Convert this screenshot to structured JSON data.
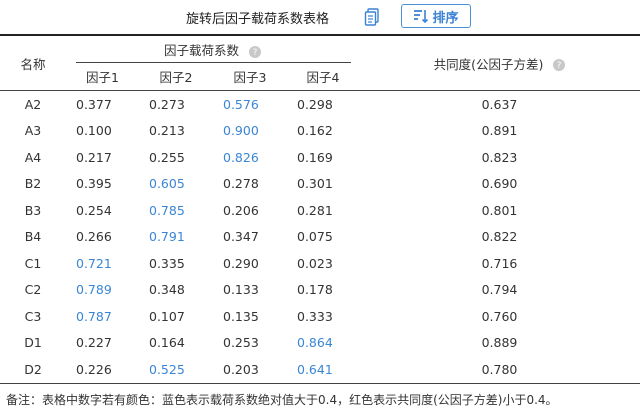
{
  "header": {
    "title": "旋转后因子载荷系数表格",
    "sort_label": "排序",
    "doc_icon": "document-icon",
    "sort_icon": "sort-icon"
  },
  "table": {
    "col_name": "名称",
    "group_label": "因子载荷系数",
    "factors": [
      "因子1",
      "因子2",
      "因子3",
      "因子4"
    ],
    "col_communality": "共同度(公因子方差)",
    "rows": [
      {
        "name": "A2",
        "f": [
          "0.377",
          "0.273",
          "0.576",
          "0.298"
        ],
        "hl": [
          false,
          false,
          true,
          false
        ],
        "comm": "0.637"
      },
      {
        "name": "A3",
        "f": [
          "0.100",
          "0.213",
          "0.900",
          "0.162"
        ],
        "hl": [
          false,
          false,
          true,
          false
        ],
        "comm": "0.891"
      },
      {
        "name": "A4",
        "f": [
          "0.217",
          "0.255",
          "0.826",
          "0.169"
        ],
        "hl": [
          false,
          false,
          true,
          false
        ],
        "comm": "0.823"
      },
      {
        "name": "B2",
        "f": [
          "0.395",
          "0.605",
          "0.278",
          "0.301"
        ],
        "hl": [
          false,
          true,
          false,
          false
        ],
        "comm": "0.690"
      },
      {
        "name": "B3",
        "f": [
          "0.254",
          "0.785",
          "0.206",
          "0.281"
        ],
        "hl": [
          false,
          true,
          false,
          false
        ],
        "comm": "0.801"
      },
      {
        "name": "B4",
        "f": [
          "0.266",
          "0.791",
          "0.347",
          "0.075"
        ],
        "hl": [
          false,
          true,
          false,
          false
        ],
        "comm": "0.822"
      },
      {
        "name": "C1",
        "f": [
          "0.721",
          "0.335",
          "0.290",
          "0.023"
        ],
        "hl": [
          true,
          false,
          false,
          false
        ],
        "comm": "0.716"
      },
      {
        "name": "C2",
        "f": [
          "0.789",
          "0.348",
          "0.133",
          "0.178"
        ],
        "hl": [
          true,
          false,
          false,
          false
        ],
        "comm": "0.794"
      },
      {
        "name": "C3",
        "f": [
          "0.787",
          "0.107",
          "0.135",
          "0.333"
        ],
        "hl": [
          true,
          false,
          false,
          false
        ],
        "comm": "0.760"
      },
      {
        "name": "D1",
        "f": [
          "0.227",
          "0.164",
          "0.253",
          "0.864"
        ],
        "hl": [
          false,
          false,
          false,
          true
        ],
        "comm": "0.889"
      },
      {
        "name": "D2",
        "f": [
          "0.226",
          "0.525",
          "0.203",
          "0.641"
        ],
        "hl": [
          false,
          true,
          false,
          true
        ],
        "comm": "0.780"
      }
    ]
  },
  "note": "备注：表格中数字若有颜色：蓝色表示载荷系数绝对值大于0.4，红色表示共同度(公因子方差)小于0.4。",
  "colors": {
    "highlight_blue": "#3a86d6",
    "button_border": "#4a90d9"
  }
}
